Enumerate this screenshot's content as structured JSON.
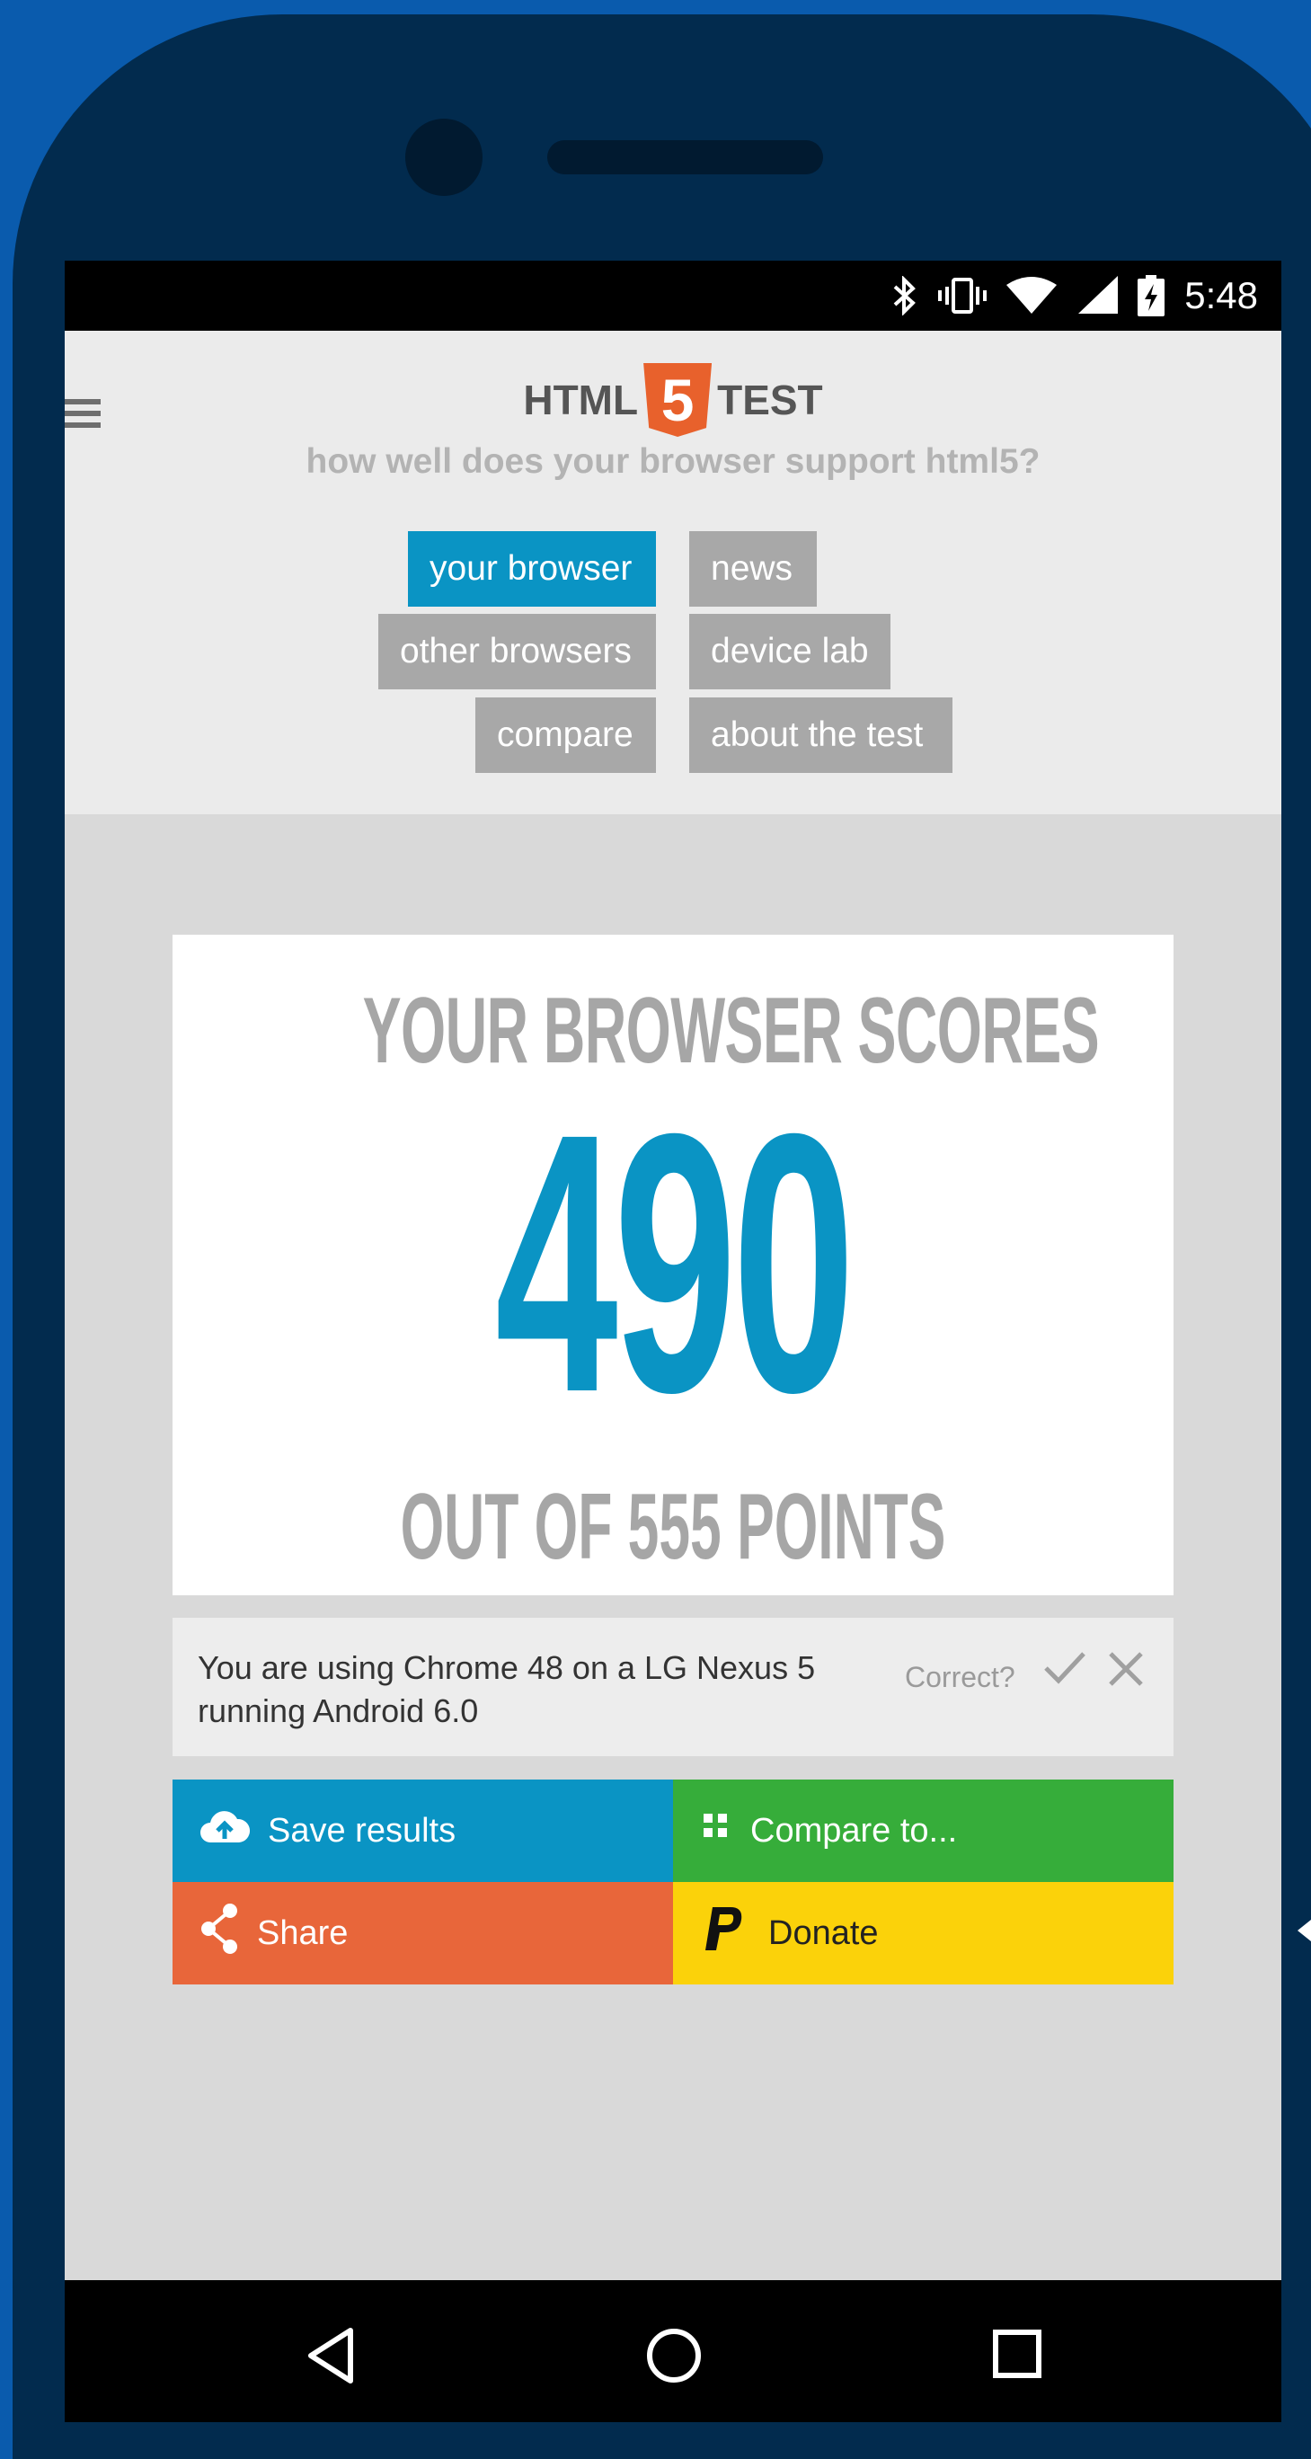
{
  "status_bar": {
    "time": "5:48"
  },
  "header": {
    "logo_left": "HTML",
    "logo_shield": "5",
    "logo_right": "TEST",
    "tagline": "how well does your browser support html5?"
  },
  "nav": {
    "your_browser": "your browser",
    "news": "news",
    "other_browsers": "other browsers",
    "device_lab": "device lab",
    "compare": "compare",
    "about": "about the test"
  },
  "score": {
    "heading": "YOUR BROWSER SCORES",
    "value": "490",
    "footer": "OUT OF 555 POINTS"
  },
  "info": {
    "line1": "You are using Chrome 48 on a LG Nexus 5",
    "line2": "running Android 6.0",
    "correct_label": "Correct?"
  },
  "actions": {
    "save": "Save results",
    "compare": "Compare to...",
    "share": "Share",
    "donate": "Donate"
  },
  "colors": {
    "accent_blue": "#0a94c4",
    "green": "#36ad3a",
    "orange": "#e8663a",
    "yellow": "#fbd20a"
  }
}
